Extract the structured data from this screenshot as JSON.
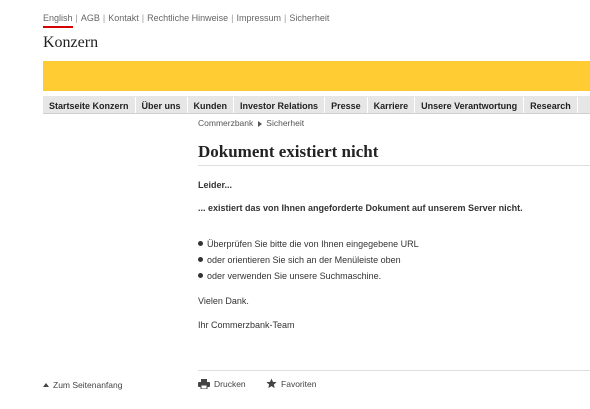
{
  "topnav": {
    "links": [
      "English",
      "AGB",
      "Kontakt",
      "Rechtliche Hinweise",
      "Impressum",
      "Sicherheit"
    ],
    "separator": "|",
    "active_color": "#d40000"
  },
  "brand": {
    "title": "Konzern",
    "accent_color": "#ffcc33"
  },
  "mainnav": {
    "items": [
      "Startseite Konzern",
      "Über uns",
      "Kunden",
      "Investor Relations",
      "Presse",
      "Karriere",
      "Unsere Verantwortung",
      "Research"
    ]
  },
  "breadcrumb": {
    "items": [
      "Commerzbank",
      "Sicherheit"
    ]
  },
  "main": {
    "title": "Dokument existiert nicht",
    "sorry": "Leider...",
    "exists_text": "... existiert das von Ihnen angeforderte Dokument auf unserem Server nicht.",
    "tips": [
      "Überprüfen Sie bitte die von Ihnen eingegebene URL",
      "oder orientieren Sie sich an der Menüleiste oben",
      "oder verwenden Sie unsere Suchmaschine."
    ],
    "thanks": "Vielen Dank.",
    "team": "Ihr Commerzbank-Team"
  },
  "footer": {
    "to_top": "Zum Seitenanfang",
    "print": "Drucken",
    "favorites": "Favoriten",
    "icons": [
      "arrow-up-icon",
      "printer-icon",
      "star-icon"
    ]
  }
}
